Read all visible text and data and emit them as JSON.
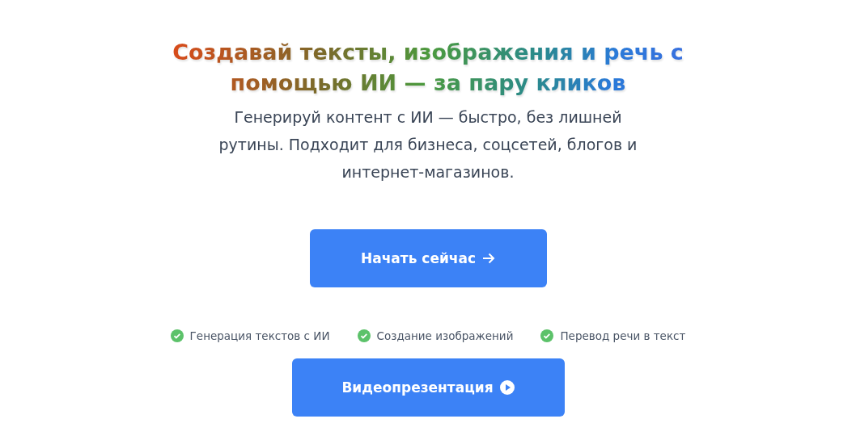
{
  "hero": {
    "title": "Создавай тексты, изображения и речь с помощью ИИ — за пару кликов",
    "subtitle": "Генерируй контент с ИИ — быстро, без лишней рутины. Подходит для бизнеса, соцсетей, блогов и интернет-магазинов.",
    "primary_button": {
      "label": "Начать сейчас"
    },
    "features": [
      {
        "label": "Генерация текстов с ИИ",
        "checked": true
      },
      {
        "label": "Создание изображений",
        "checked": true
      },
      {
        "label": "Перевод речи в текст",
        "checked": true
      }
    ],
    "video_button": {
      "label": "Видеопрезентация"
    }
  }
}
